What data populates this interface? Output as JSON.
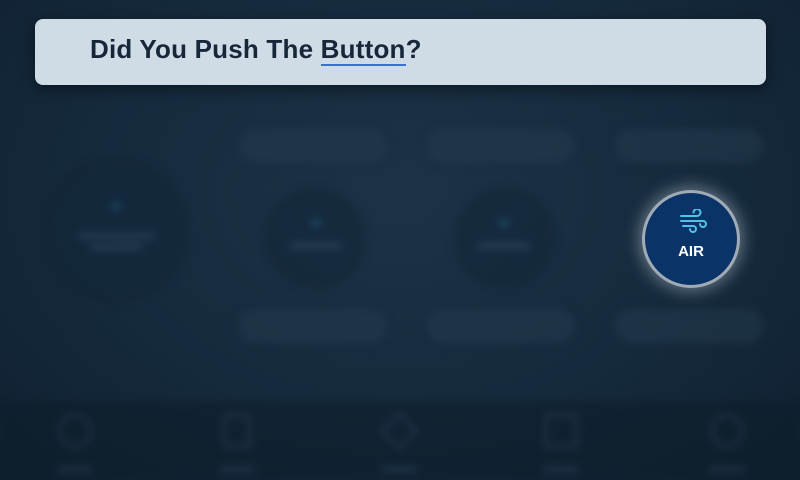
{
  "banner": {
    "title_before": "Did You Push The ",
    "title_highlight": "Button",
    "title_after": "?"
  },
  "air_button": {
    "label": "AIR",
    "icon": "wind-icon",
    "icon_color": "#4fc3e8"
  },
  "background": {
    "state": "blurred",
    "left_gauge": {
      "icon": "gauge-icon"
    },
    "controls": [
      {
        "icon": "circular-control-icon"
      },
      {
        "icon": "circular-control-icon"
      }
    ],
    "nav_items": [
      {
        "icon": "home-icon"
      },
      {
        "icon": "document-icon"
      },
      {
        "icon": "navigation-icon"
      },
      {
        "icon": "grid-icon"
      },
      {
        "icon": "settings-icon"
      }
    ]
  },
  "colors": {
    "banner_bg": "#cfdbe5",
    "banner_text": "#18263a",
    "highlight_underline": "#3d6fd0",
    "air_button_bg": "#0a3467"
  }
}
